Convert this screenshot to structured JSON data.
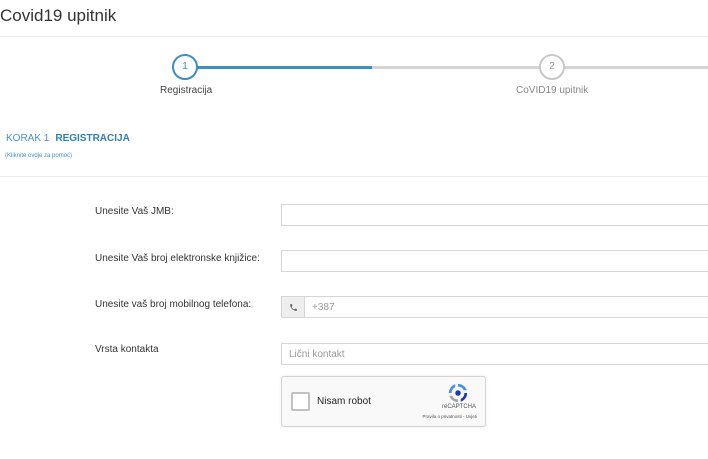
{
  "page": {
    "title": "Covid19 upitnik"
  },
  "stepper": {
    "steps": [
      {
        "number": "1",
        "label": "Registracija",
        "active": true
      },
      {
        "number": "2",
        "label": "CoVID19 upitnik",
        "active": false
      }
    ],
    "active_color": "#3a8fc4",
    "inactive_color": "#cccccc"
  },
  "section": {
    "step_prefix": "KORAK 1",
    "step_name": "REGISTRACIJA",
    "help_link": "(Kliknite ovdje za pomoć)"
  },
  "form": {
    "jmb_label": "Unesite Vaš JMB:",
    "jmb_value": "",
    "card_label": "Unesite Vaš broj elektronske knjižice:",
    "card_value": "",
    "phone_label": "Unesite vaš broj mobilnog telefona:",
    "phone_placeholder": "+387",
    "phone_value": "",
    "contact_label": "Vrsta kontakta",
    "contact_placeholder": "Lični kontakt"
  },
  "recaptcha": {
    "label": "Nisam robot",
    "brand": "reCAPTCHA",
    "links": "Pravila o privatnosti - Uvjeti",
    "checked": false
  }
}
